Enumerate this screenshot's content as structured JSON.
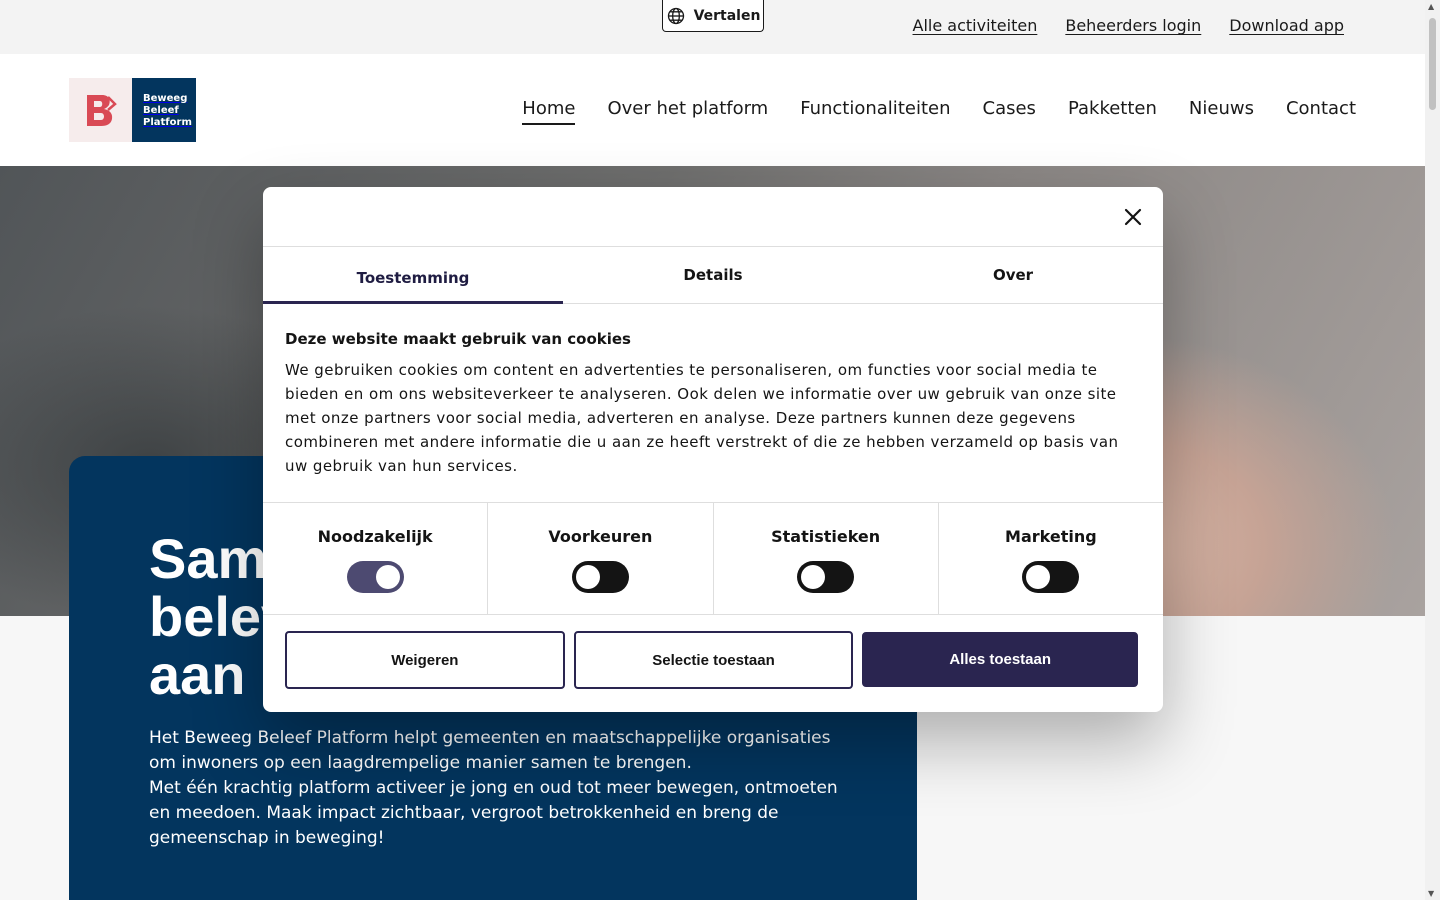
{
  "utility": {
    "translate_label": "Vertalen",
    "links": [
      "Alle activiteiten",
      "Beheerders login",
      "Download app"
    ]
  },
  "logo": {
    "line1": "Beweeg",
    "line2": "Beleef",
    "line3": "Platform",
    "brand_color": "#03355e",
    "mark_color": "#d94a55"
  },
  "nav": {
    "items": [
      "Home",
      "Over het platform",
      "Functionaliteiten",
      "Cases",
      "Pakketten",
      "Nieuws",
      "Contact"
    ],
    "active": "Home"
  },
  "hero": {
    "title_line1": "Sam",
    "title_line2": "belev",
    "title_line3": "aan d",
    "paragraph1": "Het Beweeg Beleef Platform helpt gemeenten en maatschappelijke organisaties om inwoners op een laagdrempelige manier samen te brengen.",
    "paragraph2": "Met één krachtig platform activeer je jong en oud tot meer bewegen, ontmoeten en meedoen. Maak impact zichtbaar, vergroot betrokkenheid en breng de gemeenschap in beweging!"
  },
  "cookie": {
    "tabs": [
      "Toestemming",
      "Details",
      "Over"
    ],
    "active_tab": "Toestemming",
    "heading": "Deze website maakt gebruik van cookies",
    "text": "We gebruiken cookies om content en advertenties te personaliseren, om functies voor social media te bieden en om ons websiteverkeer te analyseren. Ook delen we informatie over uw gebruik van onze site met onze partners voor social media, adverteren en analyse. Deze partners kunnen deze gegevens combineren met andere informatie die u aan ze heeft verstrekt of die ze hebben verzameld op basis van uw gebruik van hun services.",
    "categories": [
      {
        "label": "Noodzakelijk",
        "on": true
      },
      {
        "label": "Voorkeuren",
        "on": false
      },
      {
        "label": "Statistieken",
        "on": false
      },
      {
        "label": "Marketing",
        "on": false
      }
    ],
    "buttons": {
      "reject": "Weigeren",
      "selection": "Selectie toestaan",
      "accept_all": "Alles toestaan"
    },
    "accent": "#2a2550"
  }
}
